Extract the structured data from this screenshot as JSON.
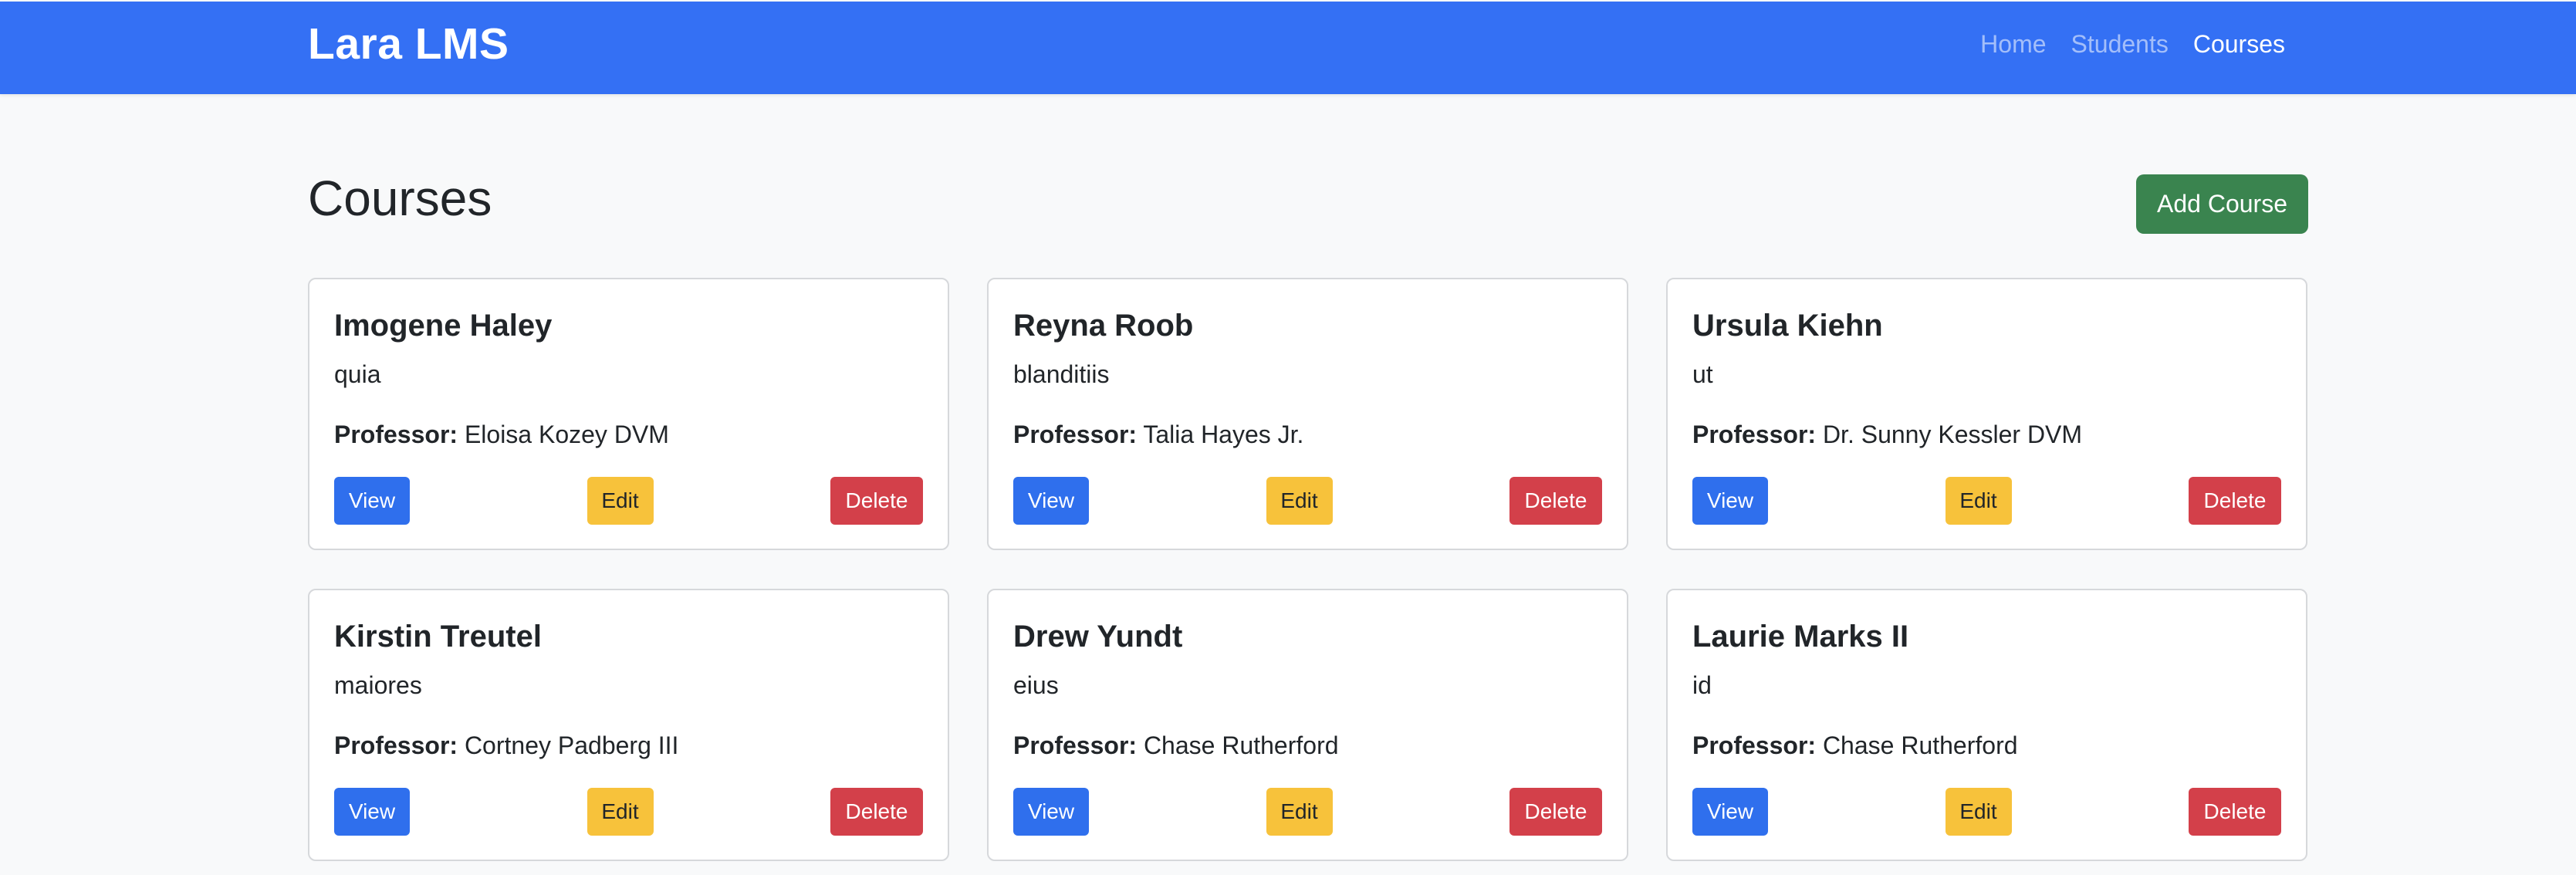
{
  "navbar": {
    "brand": "Lara LMS",
    "links": [
      {
        "label": "Home",
        "active": false
      },
      {
        "label": "Students",
        "active": false
      },
      {
        "label": "Courses",
        "active": true
      }
    ]
  },
  "page": {
    "title": "Courses",
    "add_button_label": "Add Course"
  },
  "labels": {
    "professor": "Professor:",
    "view": "View",
    "edit": "Edit",
    "delete": "Delete"
  },
  "courses": [
    {
      "name": "Imogene Haley",
      "description": "quia",
      "professor": "Eloisa Kozey DVM"
    },
    {
      "name": "Reyna Roob",
      "description": "blanditiis",
      "professor": "Talia Hayes Jr."
    },
    {
      "name": "Ursula Kiehn",
      "description": "ut",
      "professor": "Dr. Sunny Kessler DVM"
    },
    {
      "name": "Kirstin Treutel",
      "description": "maiores",
      "professor": "Cortney Padberg III"
    },
    {
      "name": "Drew Yundt",
      "description": "eius",
      "professor": "Chase Rutherford"
    },
    {
      "name": "Laurie Marks II",
      "description": "id",
      "professor": "Chase Rutherford"
    }
  ],
  "colors": {
    "navbar": "#3470f4",
    "add_button": "#3a844f",
    "view_button": "#2f6fed",
    "edit_button": "#f7c23b",
    "delete_button": "#d3404a",
    "background": "#f8f9fa"
  }
}
